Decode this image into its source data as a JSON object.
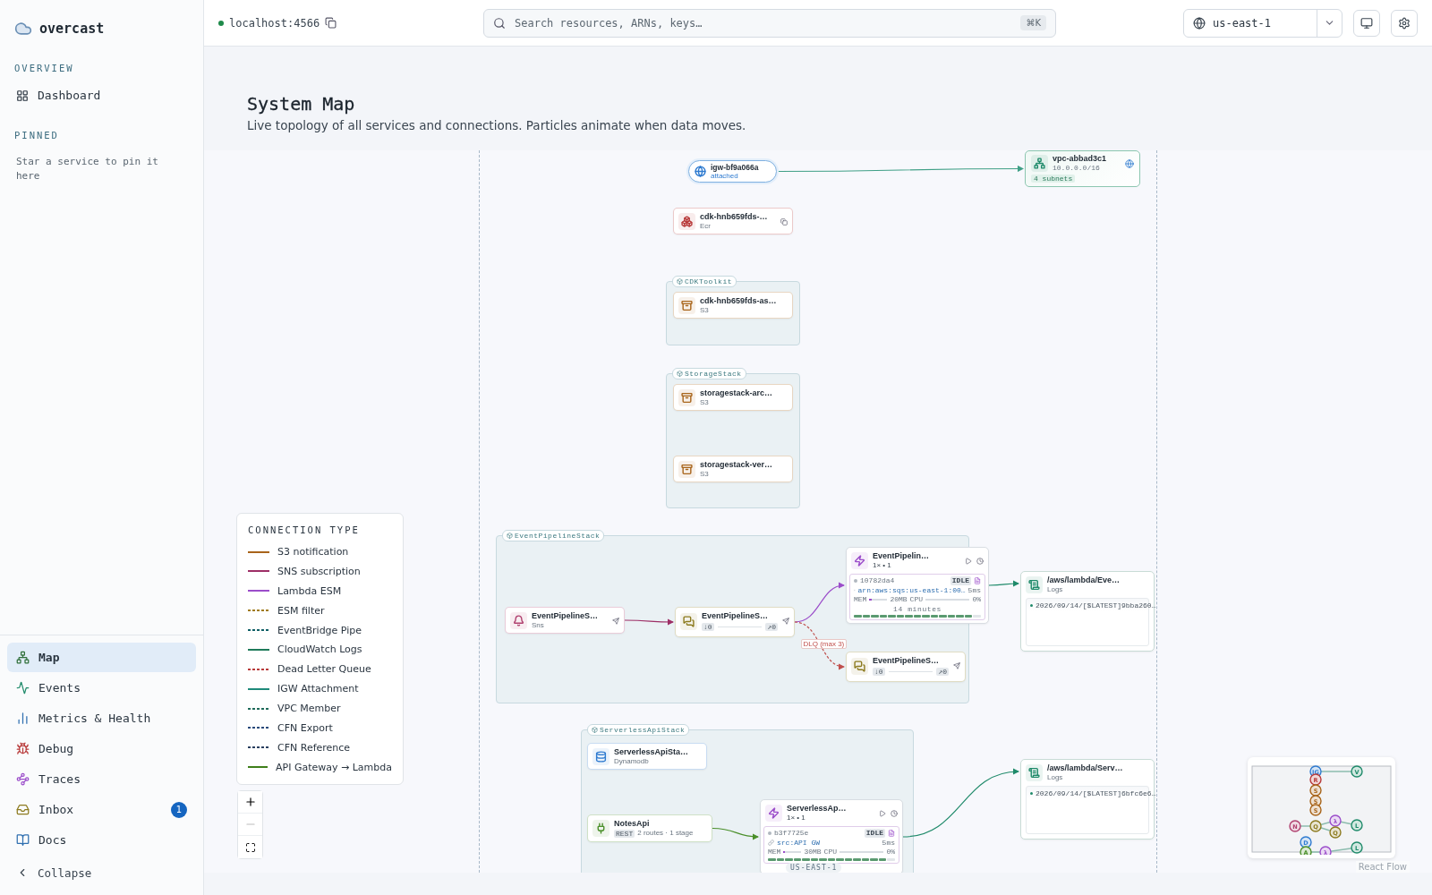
{
  "sidebar": {
    "brand": "overcast",
    "overview": {
      "heading": "OVERVIEW",
      "items": [
        {
          "label": "Dashboard",
          "selected": false
        }
      ]
    },
    "pinned": {
      "heading": "PINNED",
      "hint": "Star a service to pin it here"
    },
    "nav": [
      {
        "label": "Map",
        "selected": true
      },
      {
        "label": "Events",
        "selected": false
      },
      {
        "label": "Metrics & Health",
        "selected": false
      },
      {
        "label": "Debug",
        "selected": false
      },
      {
        "label": "Traces",
        "selected": false
      },
      {
        "label": "Inbox",
        "selected": false,
        "badge": "1"
      },
      {
        "label": "Docs",
        "selected": false
      }
    ],
    "collapse": "Collapse"
  },
  "header": {
    "endpoint": "localhost:4566",
    "connected": true,
    "search": {
      "placeholder": "Search resources, ARNs, keys…",
      "shortcut": "⌘K"
    },
    "region": "us-east-1"
  },
  "page": {
    "title": "System Map",
    "subtitle": "Live topology of all services and connections. Particles animate when data moves."
  },
  "map": {
    "region_label": "US-EAST-1",
    "groups": [
      {
        "label": "CDKToolkit"
      },
      {
        "label": "StorageStack"
      },
      {
        "label": "EventPipelineStack"
      },
      {
        "label": "ServerlessApiStack"
      }
    ],
    "nodes": [
      {
        "kind": "gateway",
        "title": "igw-bf9a066a",
        "subtitle": "attached",
        "color": "#2f7bd0"
      },
      {
        "kind": "vpc",
        "title": "vpc-abbad3c1",
        "subtitle": "10.0.0.0/16",
        "tag": "4 subnets",
        "color": "#1f8a6a"
      },
      {
        "kind": "ecr",
        "title": "cdk-hnb659fds-…",
        "subtitle": "Ecr",
        "color": "#b83a3a"
      },
      {
        "kind": "bucket",
        "title": "cdk-hnb659fds-as…",
        "subtitle": "S3",
        "color": "#a8641a"
      },
      {
        "kind": "bucket",
        "title": "storagestack-arc…",
        "subtitle": "S3",
        "color": "#a8641a"
      },
      {
        "kind": "bucket",
        "title": "storagestack-ver…",
        "subtitle": "S3",
        "color": "#a8641a"
      },
      {
        "kind": "topic",
        "title": "EventPipelineS…",
        "subtitle": "Sns",
        "color": "#b0416f"
      },
      {
        "kind": "queue",
        "title": "EventPipelineS…",
        "in": "↓0",
        "out": "↗0",
        "color": "#8c7a1e"
      },
      {
        "kind": "function",
        "title": "EventPipelin…",
        "subtitle": "1× • 1",
        "id": "10782da4",
        "status": "IDLE",
        "source": "arn:aws:sqs:us-east-1:00…",
        "duration": "5ms",
        "mem": {
          "label": "MEM",
          "value": "20MB",
          "level": 0.12
        },
        "cpu": {
          "label": "CPU",
          "value": "0%",
          "level": 0
        },
        "uptime": "14 minutes",
        "color": "#9b4dca"
      },
      {
        "kind": "queue",
        "title": "EventPipelineS…",
        "in": "↓0",
        "out": "↗0",
        "color": "#8c7a1e"
      },
      {
        "kind": "logs",
        "title": "/aws/lambda/Eve…",
        "subtitle": "Logs",
        "entries": [
          "2026/09/14/[$LATEST]9bba260…"
        ],
        "color": "#1f8a6a"
      },
      {
        "kind": "dynamodb",
        "title": "ServerlessApiSta…",
        "subtitle": "Dynamodb",
        "color": "#2f7bd0"
      },
      {
        "kind": "api",
        "title": "NotesApi",
        "badge": "REST",
        "subtitle": "2 routes · 1 stage",
        "color": "#4a8f2a"
      },
      {
        "kind": "function",
        "title": "ServerlessAp…",
        "subtitle": "1× • 1",
        "id": "b3f7725e",
        "status": "IDLE",
        "source": "src:API GW",
        "duration": "5ms",
        "mem": {
          "label": "MEM",
          "value": "30MB",
          "level": 0.06
        },
        "cpu": {
          "label": "CPU",
          "value": "0%",
          "level": 0
        },
        "color": "#9b4dca"
      },
      {
        "kind": "logs",
        "title": "/aws/lambda/Serv…",
        "subtitle": "Logs",
        "entries": [
          "2026/09/14/[$LATEST]6bfc6e6…"
        ],
        "color": "#1f8a6a"
      }
    ],
    "edges": [
      {
        "color": "#3f9f86",
        "dashed": false
      },
      {
        "color": "#9d2f66",
        "dashed": false
      },
      {
        "color": "#9b4dca",
        "dashed": false
      },
      {
        "color": "#c0504d",
        "dashed": true,
        "label": "DLQ (max 3)"
      },
      {
        "color": "#1f8a6a",
        "dashed": false
      },
      {
        "color": "#4a8f2a",
        "dashed": false
      },
      {
        "color": "#1f8a6a",
        "dashed": false
      }
    ],
    "legend": {
      "title": "CONNECTION TYPE",
      "items": [
        {
          "label": "S3 notification",
          "color": "#a8641a",
          "dashed": false
        },
        {
          "label": "SNS subscription",
          "color": "#9d2f66",
          "dashed": false
        },
        {
          "label": "Lambda ESM",
          "color": "#9b4dca",
          "dashed": false
        },
        {
          "label": "ESM filter",
          "color": "#a07a1a",
          "dashed": true
        },
        {
          "label": "EventBridge Pipe",
          "color": "#0f5f66",
          "dashed": true
        },
        {
          "label": "CloudWatch Logs",
          "color": "#1f7a5a",
          "dashed": false
        },
        {
          "label": "Dead Letter Queue",
          "color": "#b83a3a",
          "dashed": true
        },
        {
          "label": "IGW Attachment",
          "color": "#1f8a7a",
          "dashed": false
        },
        {
          "label": "VPC Member",
          "color": "#1f6a5a",
          "dashed": true
        },
        {
          "label": "CFN Export",
          "color": "#2a4a7a",
          "dashed": true
        },
        {
          "label": "CFN Reference",
          "color": "#2a3f5f",
          "dashed": true
        },
        {
          "label": "API Gateway → Lambda",
          "color": "#3f7f1a",
          "dashed": false
        }
      ]
    },
    "minimap": {
      "nodes": [
        {
          "label": "IG",
          "color": "#2f7bd0"
        },
        {
          "label": "V",
          "color": "#1f8a6a"
        },
        {
          "label": "R",
          "color": "#b83a3a"
        },
        {
          "label": "S",
          "color": "#a8641a"
        },
        {
          "label": "S",
          "color": "#a8641a"
        },
        {
          "label": "S",
          "color": "#a8641a"
        },
        {
          "label": "N",
          "color": "#b0416f"
        },
        {
          "label": "Q",
          "color": "#8c7a1e"
        },
        {
          "label": "λ",
          "color": "#9b4dca"
        },
        {
          "label": "Q",
          "color": "#8c7a1e"
        },
        {
          "label": "L",
          "color": "#1f8a6a"
        },
        {
          "label": "D",
          "color": "#2f7bd0"
        },
        {
          "label": "A",
          "color": "#4a8f2a"
        },
        {
          "label": "λ",
          "color": "#9b4dca"
        },
        {
          "label": "L",
          "color": "#1f8a6a"
        }
      ]
    },
    "attribution": "React Flow"
  }
}
